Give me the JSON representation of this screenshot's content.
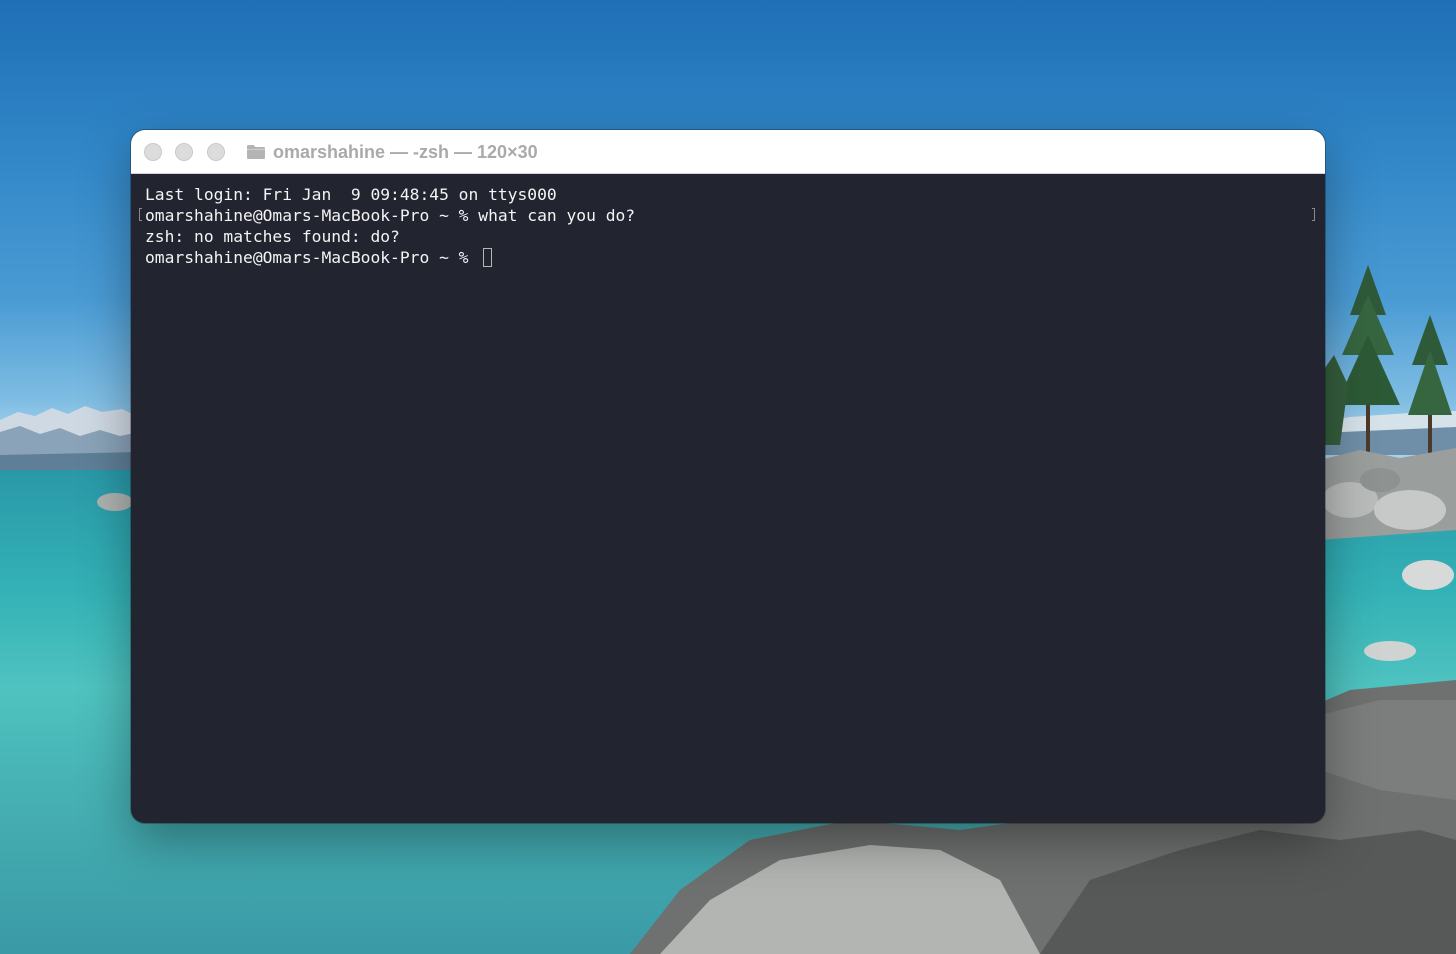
{
  "window": {
    "title": "omarshahine — -zsh — 120×30",
    "folder_icon": "folder-icon"
  },
  "terminal": {
    "lines": [
      "Last login: Fri Jan  9 09:48:45 on ttys000",
      "omarshahine@Omars-MacBook-Pro ~ % what can you do?",
      "zsh: no matches found: do?"
    ],
    "prompt": "omarshahine@Omars-MacBook-Pro ~ % ",
    "background": "#222430",
    "text_color": "#f4f4f4"
  },
  "desktop": {
    "wallpaper": "lake-shore-with-rocks-and-pines"
  }
}
